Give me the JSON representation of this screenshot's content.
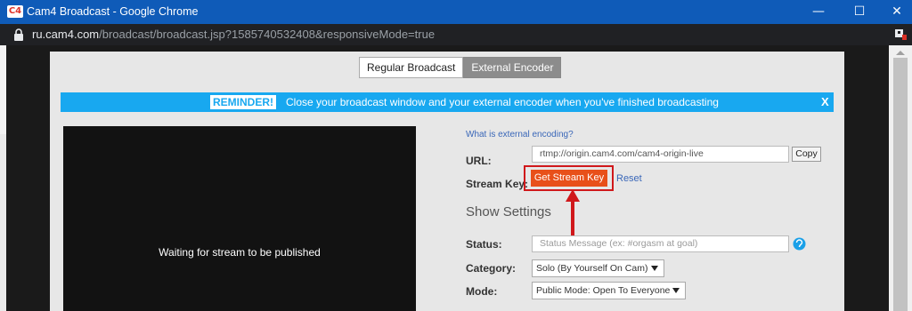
{
  "window": {
    "favicon": "C4",
    "title": "Cam4 Broadcast - Google Chrome",
    "minimize_icon": "—",
    "maximize_icon": "☐",
    "close_icon": "✕"
  },
  "address": {
    "host": "ru.cam4.com",
    "path": "/broadcast/broadcast.jsp?1585740532408&responsiveMode=true"
  },
  "tabs": {
    "regular": "Regular Broadcast",
    "external": "External Encoder"
  },
  "reminder": {
    "badge": "REMINDER!",
    "message": "Close your broadcast window and your external encoder when you've finished broadcasting",
    "close": "X"
  },
  "video": {
    "waiting_text": "Waiting for stream to be published"
  },
  "encoder": {
    "what_link": "What is external encoding?",
    "url_label": "URL:",
    "url_value": "rtmp://origin.cam4.com/cam4-origin-live",
    "copy_label": "Copy",
    "stream_key_label": "Stream Key:",
    "get_key_label": "Get Stream Key",
    "reset_label": "Reset"
  },
  "settings": {
    "heading": "Show Settings",
    "status_label": "Status:",
    "status_placeholder": "Status Message (ex: #orgasm at goal)",
    "category_label": "Category:",
    "category_value": "Solo (By Yourself On Cam)",
    "mode_label": "Mode:",
    "mode_value": "Public Mode: Open To Everyone"
  },
  "colors": {
    "titlebar": "#0f5bb8",
    "reminder": "#18a8f0",
    "get_key_button": "#e8501a",
    "highlight": "#d0181b"
  },
  "icons": {
    "lock": "lock-icon",
    "extension": "extension-icon",
    "info": "info-icon",
    "arrow": "arrow-up-icon"
  }
}
